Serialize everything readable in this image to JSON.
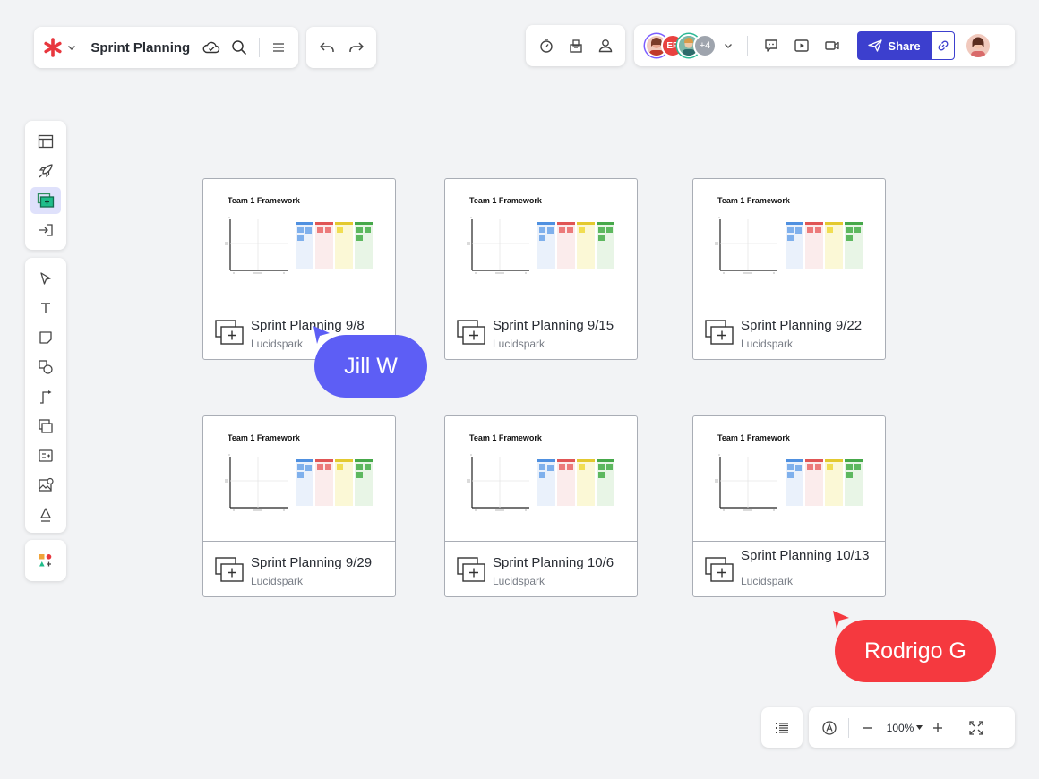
{
  "app": {
    "doc_title": "Sprint Planning",
    "brand_color": "#e8373e",
    "accent_color": "#3c3fce"
  },
  "header": {
    "collaborators": [
      {
        "initials": "",
        "icon": "avatar-photo"
      },
      {
        "initials": "EP",
        "color": "#e8413f"
      },
      {
        "initials": "",
        "icon": "avatar-photo"
      },
      {
        "initials": "+4",
        "color": "#9ea4ad"
      }
    ],
    "share_label": "Share"
  },
  "cards": [
    {
      "thumb_title": "Team 1 Framework",
      "name": "Sprint Planning 9/8",
      "source": "Lucidspark"
    },
    {
      "thumb_title": "Team 1 Framework",
      "name": "Sprint Planning 9/15",
      "source": "Lucidspark"
    },
    {
      "thumb_title": "Team 1 Framework",
      "name": "Sprint Planning 9/22",
      "source": "Lucidspark"
    },
    {
      "thumb_title": "Team 1 Framework",
      "name": "Sprint Planning 9/29",
      "source": "Lucidspark"
    },
    {
      "thumb_title": "Team 1 Framework",
      "name": "Sprint Planning 10/6",
      "source": "Lucidspark"
    },
    {
      "thumb_title": "Team 1 Framework",
      "name": "Sprint Planning 10/13",
      "source": "Lucidspark"
    }
  ],
  "cursors": {
    "jill": {
      "name": "Jill W",
      "color": "#5d5ef5"
    },
    "rodrigo": {
      "name": "Rodrigo G",
      "color": "#f5393f"
    }
  },
  "zoom": {
    "value": "100%"
  }
}
